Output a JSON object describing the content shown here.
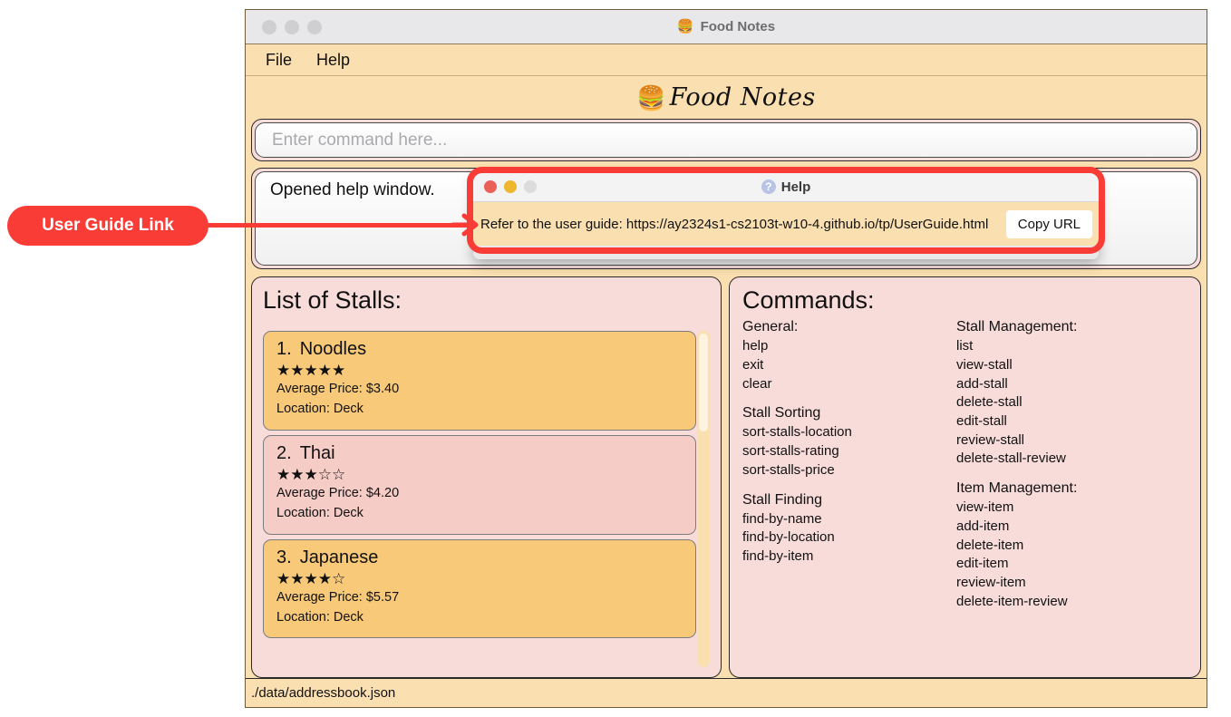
{
  "window": {
    "title": "Food Notes",
    "title_icon": "hamburger-icon",
    "traffic_lights": [
      "close",
      "minimize",
      "maximize"
    ],
    "menu": [
      "File",
      "Help"
    ],
    "logo_icon": "hamburger-icon",
    "logo_text": "Food Notes"
  },
  "command_input": {
    "placeholder": "Enter command here...",
    "value": ""
  },
  "result_box": {
    "text": "Opened help window."
  },
  "stalls_panel": {
    "title": "List of Stalls:",
    "items": [
      {
        "index": "1.",
        "name": "Noodles",
        "rating": 5,
        "stars": "★★★★★",
        "price": "Average Price: $3.40",
        "location": "Location: Deck"
      },
      {
        "index": "2.",
        "name": "Thai",
        "rating": 3,
        "stars": "★★★☆☆",
        "price": "Average Price: $4.20",
        "location": "Location: Deck"
      },
      {
        "index": "3.",
        "name": "Japanese",
        "rating": 4,
        "stars": "★★★★☆",
        "price": "Average Price: $5.57",
        "location": "Location: Deck"
      }
    ]
  },
  "commands_panel": {
    "title": "Commands:",
    "left_column": [
      {
        "heading": "General:",
        "entries": [
          "help",
          "exit",
          "clear"
        ]
      },
      {
        "heading": "Stall Sorting",
        "entries": [
          "sort-stalls-location",
          "sort-stalls-rating",
          "sort-stalls-price"
        ]
      },
      {
        "heading": "Stall Finding",
        "entries": [
          "find-by-name",
          "find-by-location",
          "find-by-item"
        ]
      }
    ],
    "right_column": [
      {
        "heading": "Stall Management:",
        "entries": [
          "list",
          "view-stall",
          "add-stall",
          "delete-stall",
          "edit-stall",
          "review-stall",
          "delete-stall-review"
        ]
      },
      {
        "heading": "Item Management:",
        "entries": [
          "view-item",
          "add-item",
          "delete-item",
          "edit-item",
          "review-item",
          "delete-item-review"
        ]
      }
    ]
  },
  "status_bar": {
    "path": "./data/addressbook.json"
  },
  "help_window": {
    "title": "Help",
    "title_icon": "question-mark-icon",
    "question_glyph": "?",
    "traffic_lights": [
      "close",
      "minimize",
      "maximize"
    ],
    "url_text": "Refer to the user guide: https://ay2324s1-cs2103t-w10-4.github.io/tp/UserGuide.html",
    "copy_button": "Copy URL"
  },
  "annotation": {
    "label": "User Guide Link",
    "color": "#f93c36"
  },
  "colors": {
    "window_bg": "#fadfb0",
    "panel_bg": "#f7dcda",
    "card_odd": "#f8c979",
    "card_even": "#f6ccc6",
    "titlebar": "#e8e8ea",
    "accent_red": "#f93c36"
  }
}
